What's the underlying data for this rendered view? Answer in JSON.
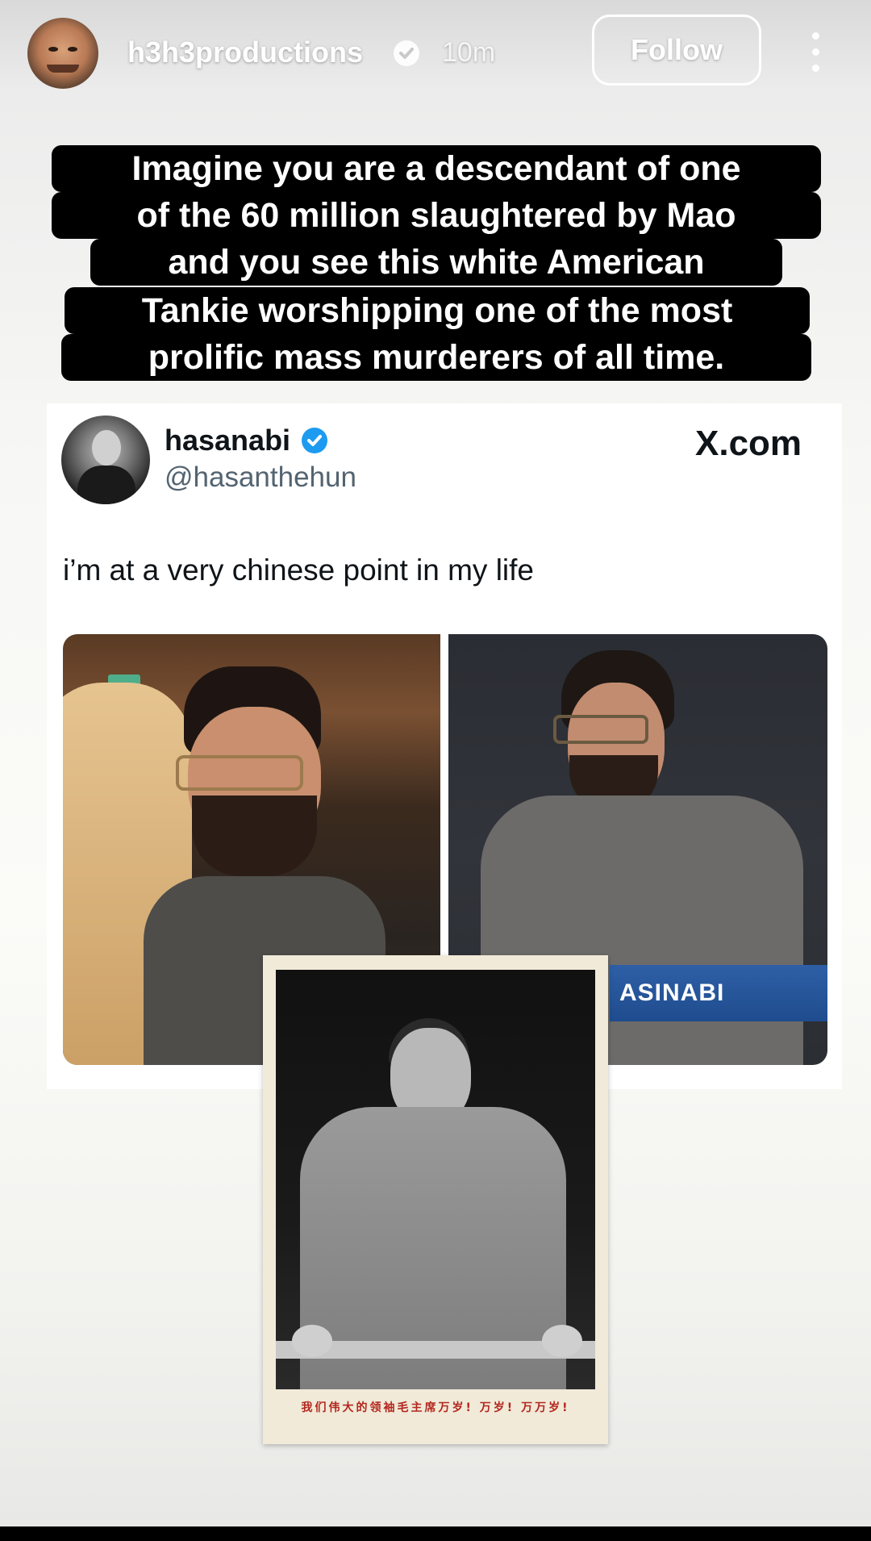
{
  "header": {
    "username": "h3h3productions",
    "time": "10m",
    "follow_label": "Follow"
  },
  "caption": {
    "lines": [
      "Imagine you are a descendant of one",
      "of the 60 million slaughtered by Mao",
      "and you see this white American",
      "Tankie worshipping one of the most",
      "prolific mass murderers of all time."
    ]
  },
  "tweet": {
    "name": "hasanabi",
    "handle": "@hasanthehun",
    "source": "X.com",
    "text": "i’m at a very chinese point in my life",
    "nameplate": "ASINABI"
  },
  "poster": {
    "slogan": "我们伟大的领袖毛主席万岁! 万岁! 万万岁!"
  },
  "colors": {
    "verified_header": "#ffffff",
    "verified_tweet": "#1d9bf0",
    "slogan": "#b3261e",
    "caption_bg": "#000000"
  },
  "icons": [
    "verified-badge-icon",
    "more-options-icon",
    "x-verified-icon"
  ]
}
